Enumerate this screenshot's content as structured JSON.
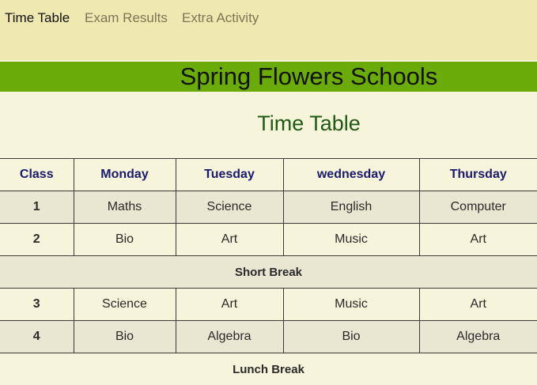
{
  "nav": {
    "items": [
      {
        "label": "Time Table",
        "active": true
      },
      {
        "label": "Exam Results",
        "active": false
      },
      {
        "label": "Extra Activity",
        "active": false
      }
    ]
  },
  "header": {
    "school_name": "Spring Flowers Schools"
  },
  "main": {
    "title": "Time Table"
  },
  "table": {
    "columns": [
      "Class",
      "Monday",
      "Tuesday",
      "wednesday",
      "Thursday"
    ],
    "rows": [
      [
        "1",
        "Maths",
        "Science",
        "English",
        "Computer"
      ],
      [
        "2",
        "Bio",
        "Art",
        "Music",
        "Art"
      ],
      [
        "3",
        "Science",
        "Art",
        "Music",
        "Art"
      ],
      [
        "4",
        "Bio",
        "Algebra",
        "Bio",
        "Algebra"
      ]
    ],
    "short_break": "Short Break",
    "lunch_break": "Lunch Break"
  },
  "colors": {
    "nav_bg": "#efe8b0",
    "banner_bg": "#6aab0a",
    "page_bg": "#f6f4da",
    "header_text": "#1a1a6e",
    "title_text": "#1f5a12"
  }
}
